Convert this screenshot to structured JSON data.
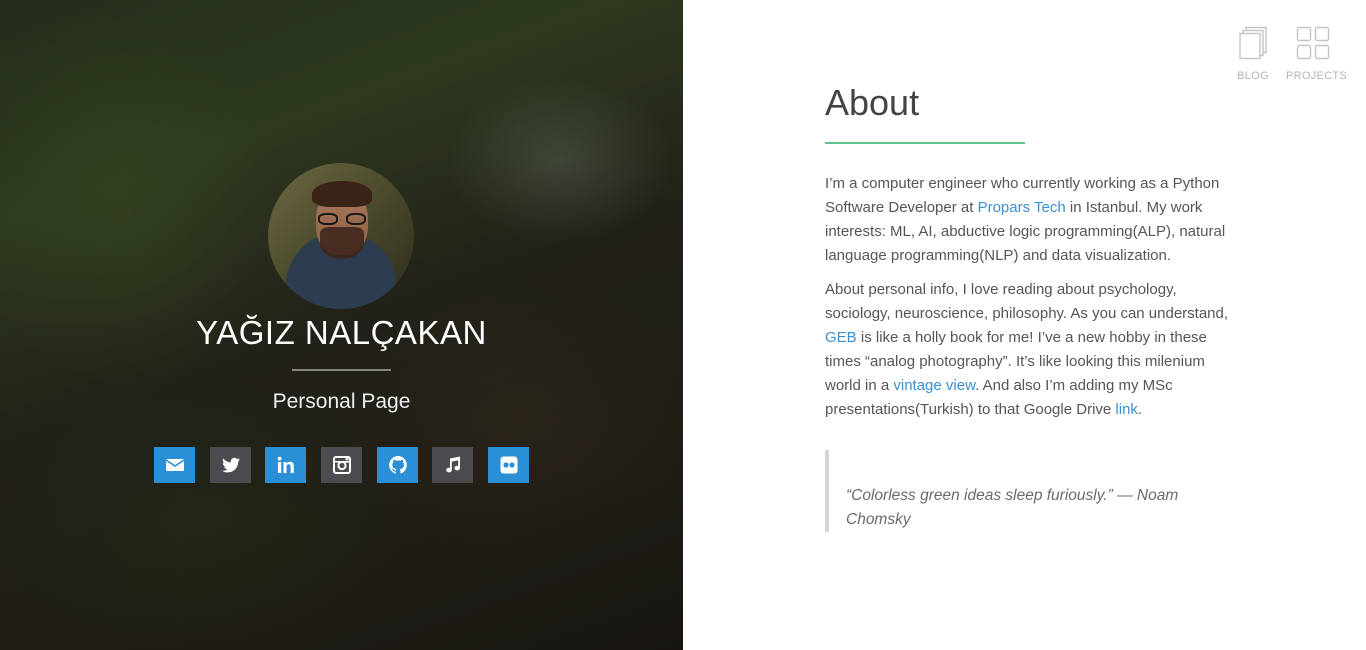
{
  "profile": {
    "name": "YAĞIZ NALÇAKAN",
    "subtitle": "Personal Page"
  },
  "socials": [
    {
      "icon": "envelope-icon",
      "color": "#2b8fd6"
    },
    {
      "icon": "twitter-icon",
      "color": "#4c4c50"
    },
    {
      "icon": "linkedin-icon",
      "color": "#2b8fd6"
    },
    {
      "icon": "instagram-icon",
      "color": "#4c4c50"
    },
    {
      "icon": "github-icon",
      "color": "#2b8fd6"
    },
    {
      "icon": "music-icon",
      "color": "#4c4c50"
    },
    {
      "icon": "flickr-icon",
      "color": "#2b8fd6"
    }
  ],
  "nav": {
    "blog": "BLOG",
    "projects": "PROJECTS"
  },
  "about": {
    "title": "About",
    "p1": {
      "t1": "I’m a computer engineer who currently working as a Python Software Developer at ",
      "link": "Propars Tech",
      "t2": " in Istanbul. My work interests: ML, AI, abductive logic programming(ALP), natural language programming(NLP) and data visualization."
    },
    "p2": {
      "t1": "About personal info, I love reading about psychology, sociology, neuroscience, philosophy. As you can understand, ",
      "link1": "GEB",
      "t2": " is like a holly book for me! I’ve a new hobby in these times “analog photography”. It’s like looking this milenium world in a ",
      "link2": "vintage view",
      "t3": ". And also I’m adding my MSc presentations(Turkish) to that Google Drive ",
      "link3": "link",
      "t4": "."
    },
    "quote": "“Colorless green ideas sleep furiously.” — Noam Chomsky"
  },
  "colors": {
    "accent_blue": "#2b8fd6",
    "accent_green": "#5fc28a",
    "link": "#3a90d0"
  }
}
